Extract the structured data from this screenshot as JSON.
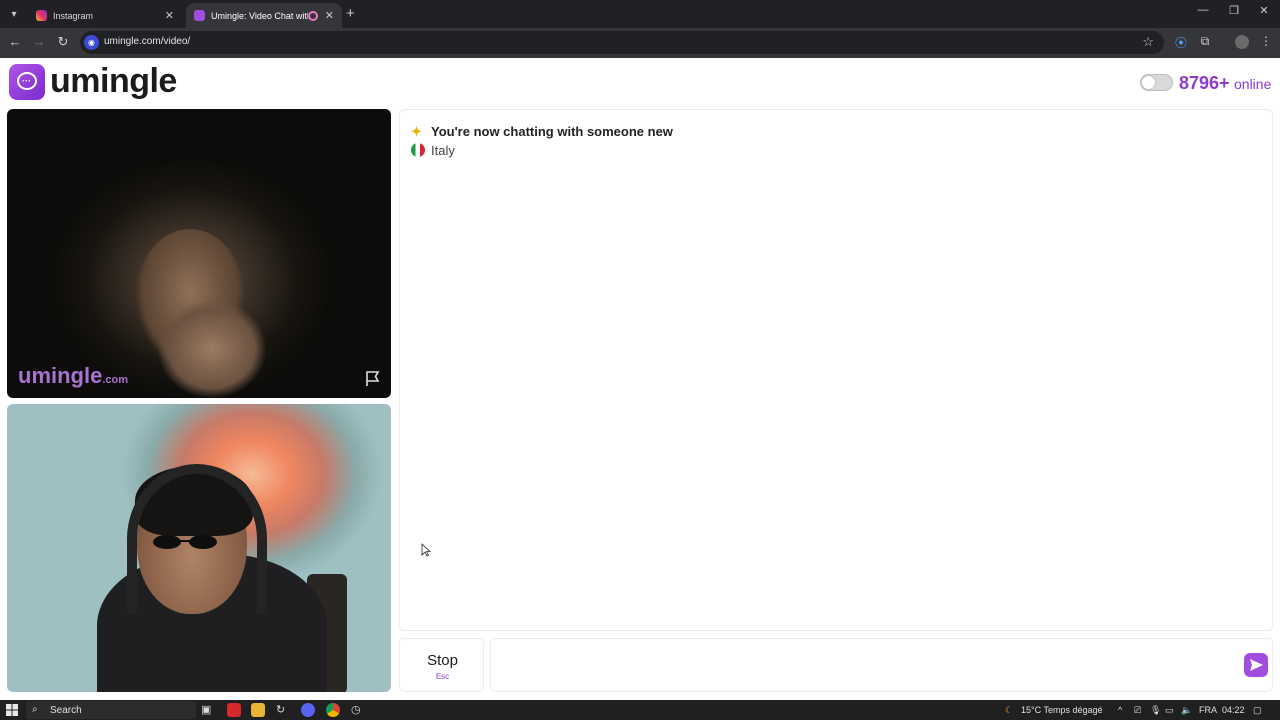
{
  "browser": {
    "tabs": [
      {
        "title": "Instagram",
        "favicon_color": "#e1306c"
      },
      {
        "title": "Umingle: Video Chat with S",
        "favicon_color": "#a14ee0"
      }
    ],
    "url": "umingle.com/video/"
  },
  "header": {
    "logo_text": "umingle",
    "online_count": "8796+",
    "online_label": "online"
  },
  "video": {
    "watermark": "umingle",
    "watermark_suffix": ".com"
  },
  "chat": {
    "system_message": "You're now chatting with someone new",
    "country": "Italy"
  },
  "controls": {
    "stop_label": "Stop",
    "stop_shortcut": "Esc",
    "message_placeholder": ""
  },
  "taskbar": {
    "search_label": "Search",
    "weather": "15°C  Temps dégagé",
    "language": "FRA",
    "time": "04:22"
  },
  "colors": {
    "brand": "#8b3bcf",
    "send_button": "#a14ee0"
  }
}
